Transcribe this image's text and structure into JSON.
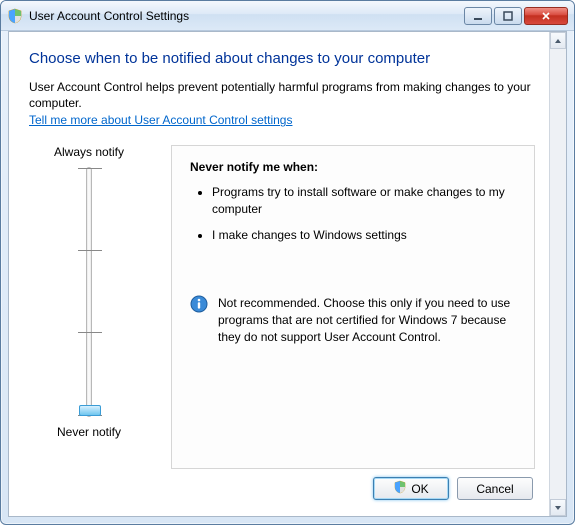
{
  "window": {
    "title": "User Account Control Settings"
  },
  "heading": "Choose when to be notified about changes to your computer",
  "intro": "User Account Control helps prevent potentially harmful programs from making changes to your computer.",
  "link": "Tell me more about User Account Control settings",
  "slider": {
    "top_label": "Always notify",
    "bottom_label": "Never notify",
    "position": 3,
    "levels": 4
  },
  "panel": {
    "heading": "Never notify me when:",
    "bullets": [
      "Programs try to install software or make changes to my computer",
      "I make changes to Windows settings"
    ],
    "note": "Not recommended. Choose this only if you need to use programs that are not certified for Windows 7 because they do not support User Account Control."
  },
  "buttons": {
    "ok": "OK",
    "cancel": "Cancel"
  }
}
